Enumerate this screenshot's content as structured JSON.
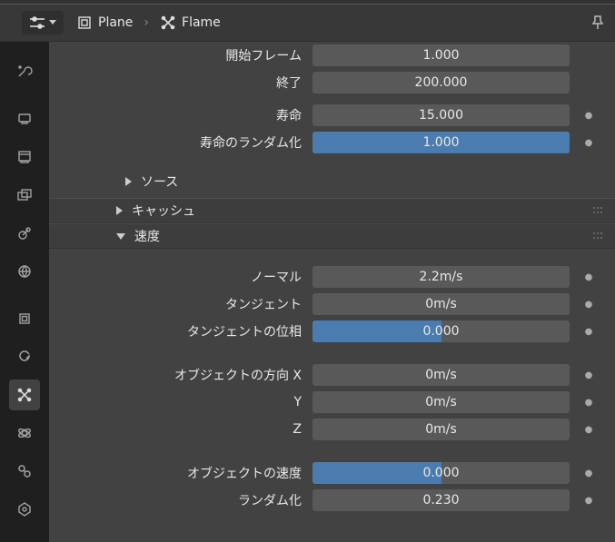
{
  "header": {
    "object_name": "Plane",
    "data_name": "Flame"
  },
  "emission": {
    "frame_start_label": "開始フレーム",
    "frame_start": "1.000",
    "frame_end_label": "終了",
    "frame_end": "200.000",
    "lifetime_label": "寿命",
    "lifetime": "15.000",
    "lifetime_random_label": "寿命のランダム化",
    "lifetime_random": "1.000",
    "lifetime_random_fill": 100
  },
  "panels": {
    "source": "ソース",
    "cache": "キャッシュ",
    "velocity": "速度"
  },
  "velocity": {
    "normal_label": "ノーマル",
    "normal": "2.2m/s",
    "tangent_label": "タンジェント",
    "tangent": "0m/s",
    "tangent_phase_label": "タンジェントの位相",
    "tangent_phase": "0.000",
    "tangent_phase_fill": 50,
    "obj_align_label": "オブジェクトの方向 X",
    "obj_align_x": "0m/s",
    "obj_align_y_label": "Y",
    "obj_align_y": "0m/s",
    "obj_align_z_label": "Z",
    "obj_align_z": "0m/s",
    "obj_vel_label": "オブジェクトの速度",
    "obj_vel": "0.000",
    "obj_vel_fill": 50,
    "random_label": "ランダム化",
    "random": "0.230"
  }
}
